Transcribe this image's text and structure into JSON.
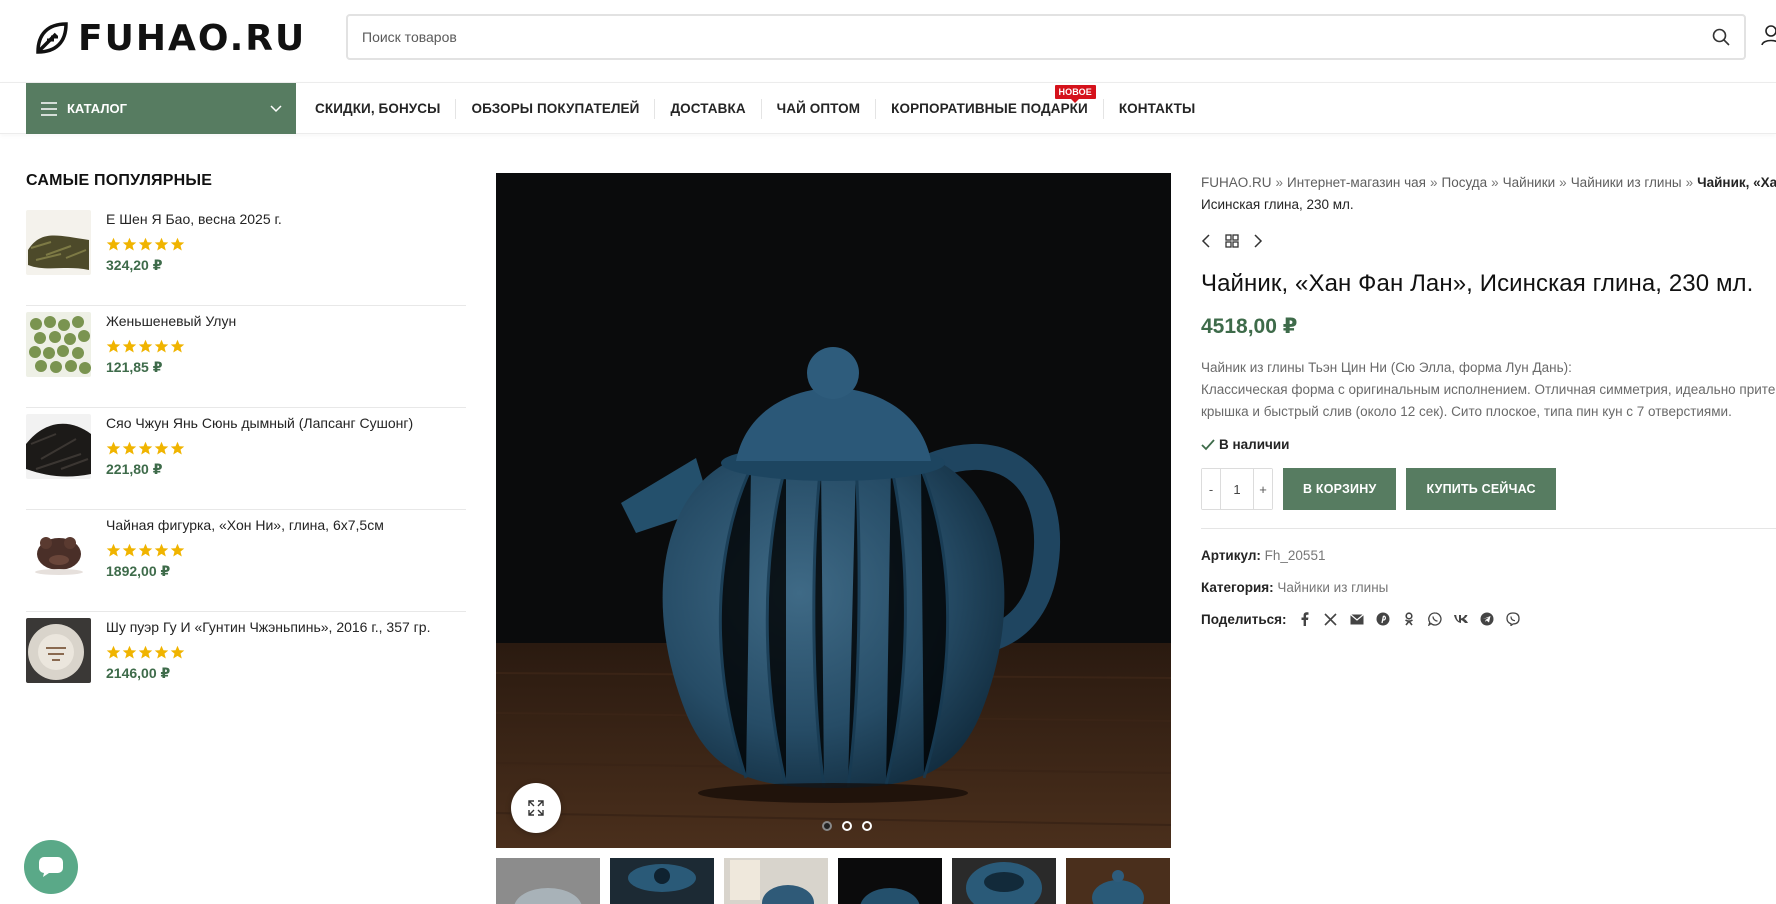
{
  "header": {
    "logo_text": "FUHAO.RU",
    "search_placeholder": "Поиск товаров"
  },
  "nav": {
    "catalog_label": "КАТАЛОГ",
    "items": [
      {
        "label": "СКИДКИ, БОНУСЫ"
      },
      {
        "label": "ОБЗОРЫ ПОКУПАТЕЛЕЙ"
      },
      {
        "label": "ДОСТАВКА"
      },
      {
        "label": "ЧАЙ ОПТОМ"
      },
      {
        "label": "КОРПОРАТИВНЫЕ ПОДАРКИ",
        "badge": "НОВОЕ"
      },
      {
        "label": "КОНТАКТЫ"
      }
    ]
  },
  "sidebar": {
    "title": "САМЫЕ ПОПУЛЯРНЫЕ",
    "products": [
      {
        "name": "Е Шен Я Бао, весна 2025 г.",
        "rating": 5,
        "price": "324,20 ₽"
      },
      {
        "name": "Женьшеневый Улун",
        "rating": 5,
        "price": "121,85 ₽"
      },
      {
        "name": "Сяо Чжун Янь Сюнь дымный (Лапсанг Сушонг)",
        "rating": 5,
        "price": "221,80 ₽"
      },
      {
        "name": "Чайная фигурка, «Хон Ни», глина, 6х7,5см",
        "rating": 5,
        "price": "1892,00 ₽"
      },
      {
        "name": "Шу пуэр Гу И «Гунтин Чжэньпинь», 2016 г., 357 гр.",
        "rating": 5,
        "price": "2146,00 ₽"
      }
    ]
  },
  "gallery": {
    "slide_count": 3,
    "active_slide": 1,
    "thumbnail_count": 6
  },
  "product": {
    "breadcrumb": [
      "FUHAO.RU",
      "Интернет-магазин чая",
      "Посуда",
      "Чайники",
      "Чайники из глины"
    ],
    "breadcrumb_current_part1": "Чайник, «Хан Фан Лан»,",
    "breadcrumb_current_part2": "Исинская глина, 230 мл.",
    "title": "Чайник, «Хан Фан Лан», Исинская глина, 230 мл.",
    "price": "4518,00 ₽",
    "description_lines": [
      "Чайник из глины Тьэн Цин Ни (Сю Элла, форма Лун Дань):",
      "Классическая форма с оригинальным исполнением. Отличная симметрия, идеально притертая",
      "крышка и быстрый слив (около 12 сек). Сито плоское, типа пин кун с 7 отверстиями."
    ],
    "stock": "В наличии",
    "quantity": "1",
    "qty_minus": "-",
    "qty_plus": "+",
    "add_to_cart": "В КОРЗИНУ",
    "buy_now": "КУПИТЬ СЕЙЧАС",
    "sku_label": "Артикул:",
    "sku": "Fh_20551",
    "category_label": "Категория:",
    "category": "Чайники из глины",
    "share_label": "Поделиться:",
    "share_icons": [
      "facebook-icon",
      "x-icon",
      "email-icon",
      "pinterest-icon",
      "odnoklassniki-icon",
      "whatsapp-icon",
      "vk-icon",
      "telegram-icon",
      "viber-icon"
    ]
  },
  "colors": {
    "brand_green": "#577c61",
    "price_green": "#3e6b4a",
    "star": "#f0b400",
    "badge_red": "#d5121b"
  }
}
